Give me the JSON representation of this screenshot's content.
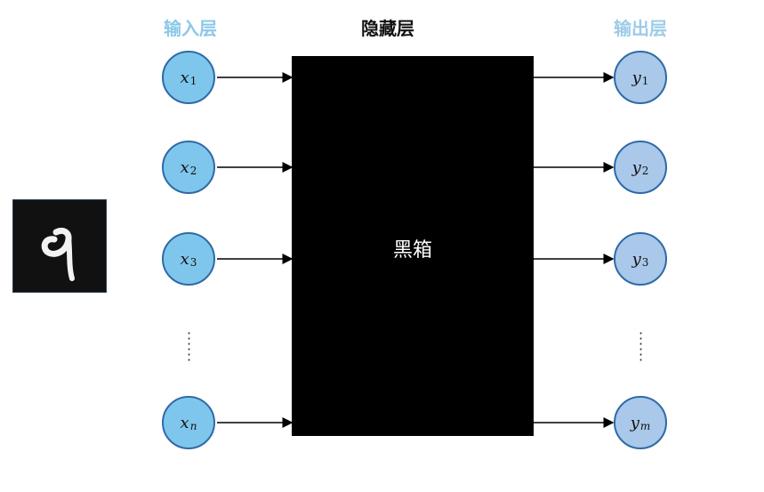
{
  "layers": {
    "input_title": "输入层",
    "hidden_title": "隐藏层",
    "output_title": "输出层"
  },
  "colors": {
    "input_title": "#8cc8e8",
    "output_title": "#9ecbe8",
    "input_node_fill": "#7fc6ec",
    "output_node_fill": "#a9c8ea",
    "node_border": "#2f6aa6",
    "blackbox": "#000000"
  },
  "inputs": [
    {
      "var": "x",
      "sub": "1"
    },
    {
      "var": "x",
      "sub": "2"
    },
    {
      "var": "x",
      "sub": "3"
    },
    {
      "var": "x",
      "sub": "n"
    }
  ],
  "outputs": [
    {
      "var": "y",
      "sub": "1"
    },
    {
      "var": "y",
      "sub": "2"
    },
    {
      "var": "y",
      "sub": "3"
    },
    {
      "var": "y",
      "sub": "m"
    }
  ],
  "blackbox": {
    "label": "黑箱"
  },
  "digit_image": {
    "depicts": "handwritten digit 9"
  }
}
